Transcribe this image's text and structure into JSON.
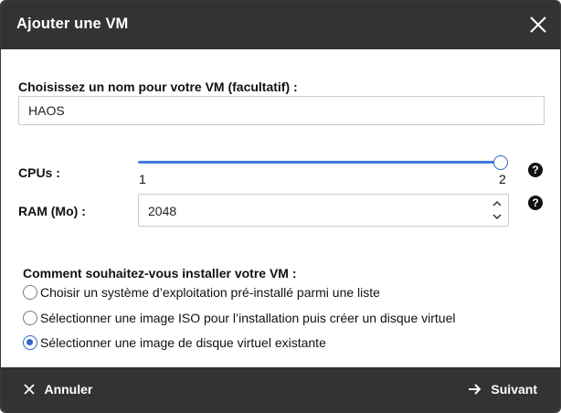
{
  "dialog": {
    "title": "Ajouter une VM",
    "close_icon": "close-icon"
  },
  "name_field": {
    "label": "Choisissez un nom pour votre VM (facultatif) :",
    "value": "HAOS"
  },
  "cpu": {
    "label": "CPUs :",
    "min_label": "1",
    "max_label": "2",
    "value": 2,
    "help_icon": "question-circle-icon",
    "help_glyph": "?"
  },
  "ram": {
    "label": "RAM (Mo) :",
    "value": "2048",
    "help_icon": "question-circle-icon",
    "help_glyph": "?"
  },
  "install": {
    "label": "Comment souhaitez-vous installer votre VM :",
    "options": [
      {
        "label": "Choisir un système d’exploitation pré-installé parmi une liste",
        "selected": false
      },
      {
        "label": "Sélectionner une image ISO pour l’installation puis créer un disque virtuel",
        "selected": false
      },
      {
        "label": "Sélectionner une image de disque virtuel existante",
        "selected": true
      }
    ]
  },
  "footer": {
    "cancel_label": "Annuler",
    "cancel_icon": "close-icon",
    "next_label": "Suivant",
    "next_icon": "arrow-right-icon"
  },
  "colors": {
    "header_bg": "#333333",
    "accent": "#2f67c6"
  }
}
